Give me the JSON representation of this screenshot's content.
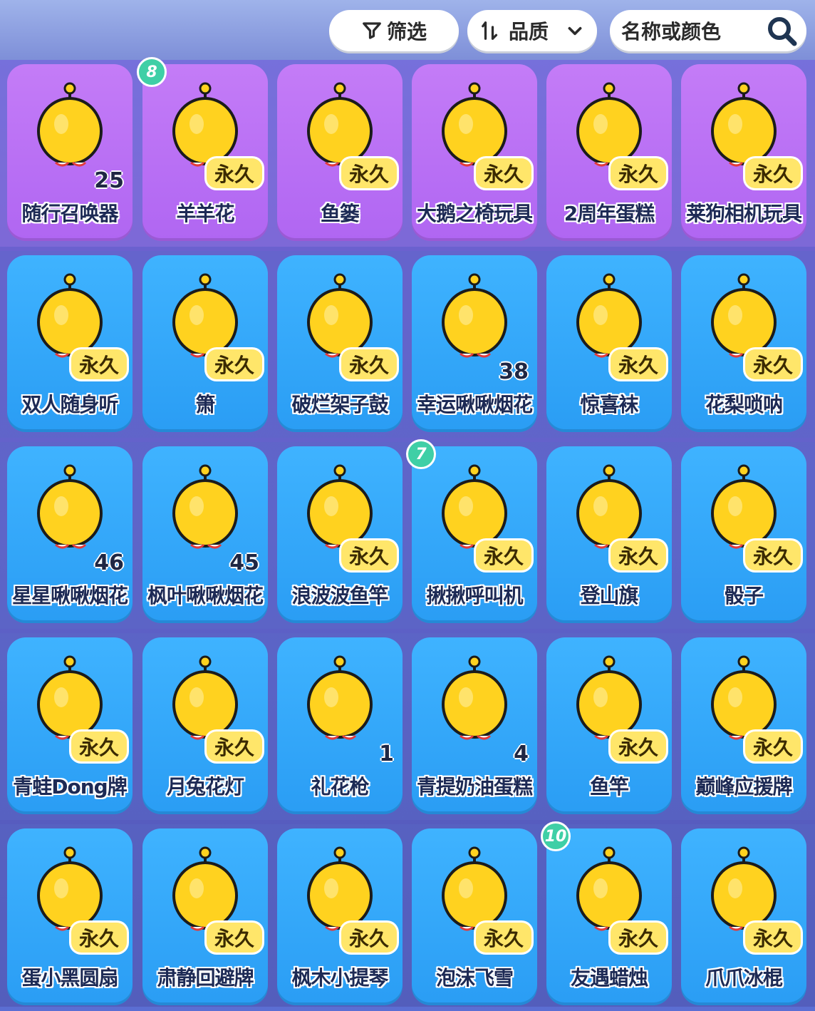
{
  "toolbar": {
    "filter_label": "筛选",
    "sort_label": "品质",
    "search_placeholder": "名称或颜色"
  },
  "colors": {
    "purple_card": "#b066f2",
    "blue_card": "#2a9df4",
    "badge": "#ffe66a",
    "new_tag": "#3fcfa6"
  },
  "items": [
    {
      "name": "随行召唤器",
      "rarity": "purple",
      "count": "25",
      "badge": ""
    },
    {
      "name": "羊羊花",
      "rarity": "purple",
      "count": "",
      "badge": "永久",
      "tag": "8"
    },
    {
      "name": "鱼篓",
      "rarity": "purple",
      "count": "",
      "badge": "永久"
    },
    {
      "name": "大鹅之椅玩具",
      "rarity": "purple",
      "count": "",
      "badge": "永久"
    },
    {
      "name": "2周年蛋糕",
      "rarity": "purple",
      "count": "",
      "badge": "永久"
    },
    {
      "name": "莱狗相机玩具",
      "rarity": "purple",
      "count": "",
      "badge": "永久"
    },
    {
      "name": "双人随身听",
      "rarity": "blue",
      "count": "",
      "badge": "永久"
    },
    {
      "name": "箫",
      "rarity": "blue",
      "count": "",
      "badge": "永久"
    },
    {
      "name": "破烂架子鼓",
      "rarity": "blue",
      "count": "",
      "badge": "永久"
    },
    {
      "name": "幸运啾啾烟花",
      "rarity": "blue",
      "count": "38",
      "badge": ""
    },
    {
      "name": "惊喜袜",
      "rarity": "blue",
      "count": "",
      "badge": "永久"
    },
    {
      "name": "花梨唢呐",
      "rarity": "blue",
      "count": "",
      "badge": "永久"
    },
    {
      "name": "星星啾啾烟花",
      "rarity": "blue",
      "count": "46",
      "badge": ""
    },
    {
      "name": "枫叶啾啾烟花",
      "rarity": "blue",
      "count": "45",
      "badge": ""
    },
    {
      "name": "浪波波鱼竿",
      "rarity": "blue",
      "count": "",
      "badge": "永久"
    },
    {
      "name": "揪揪呼叫机",
      "rarity": "blue",
      "count": "",
      "badge": "永久",
      "tag": "7"
    },
    {
      "name": "登山旗",
      "rarity": "blue",
      "count": "",
      "badge": "永久"
    },
    {
      "name": "骰子",
      "rarity": "blue",
      "count": "",
      "badge": "永久"
    },
    {
      "name": "青蛙Dong牌",
      "rarity": "blue",
      "count": "",
      "badge": "永久"
    },
    {
      "name": "月兔花灯",
      "rarity": "blue",
      "count": "",
      "badge": "永久"
    },
    {
      "name": "礼花枪",
      "rarity": "blue",
      "count": "1",
      "badge": ""
    },
    {
      "name": "青提奶油蛋糕",
      "rarity": "blue",
      "count": "4",
      "badge": ""
    },
    {
      "name": "鱼竿",
      "rarity": "blue",
      "count": "",
      "badge": "永久"
    },
    {
      "name": "巅峰应援牌",
      "rarity": "blue",
      "count": "",
      "badge": "永久"
    },
    {
      "name": "蛋小黑圆扇",
      "rarity": "blue",
      "count": "",
      "badge": "永久"
    },
    {
      "name": "肃静回避牌",
      "rarity": "blue",
      "count": "",
      "badge": "永久"
    },
    {
      "name": "枫木小提琴",
      "rarity": "blue",
      "count": "",
      "badge": "永久"
    },
    {
      "name": "泡沫飞雪",
      "rarity": "blue",
      "count": "",
      "badge": "永久"
    },
    {
      "name": "友遇蜡烛",
      "rarity": "blue",
      "count": "",
      "badge": "永久",
      "tag": "10"
    },
    {
      "name": "爪爪冰棍",
      "rarity": "blue",
      "count": "",
      "badge": "永久"
    }
  ]
}
